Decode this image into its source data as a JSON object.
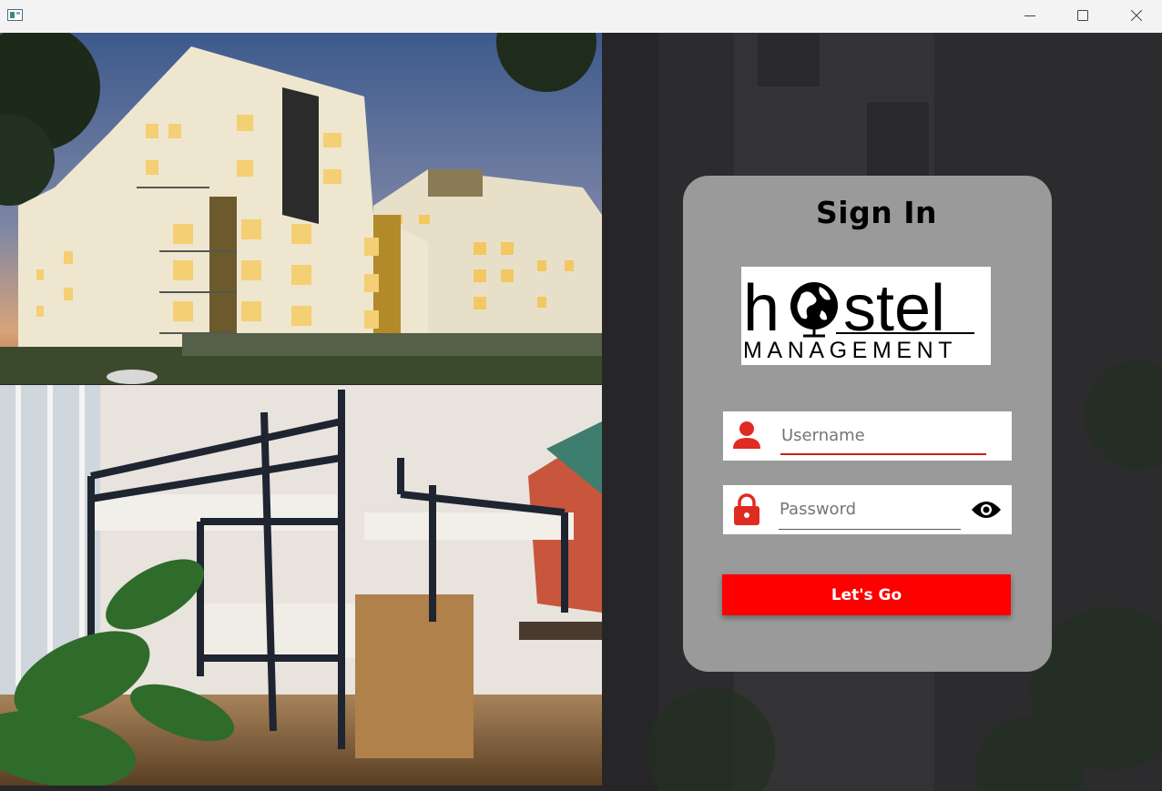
{
  "window": {
    "minimize_icon": "minimize-icon",
    "maximize_icon": "maximize-icon",
    "close_icon": "close-icon"
  },
  "signin": {
    "title": "Sign In",
    "logo": {
      "word": "hostel",
      "sub": "MANAGEMENT",
      "icon": "globe-icon"
    },
    "username": {
      "placeholder": "Username",
      "value": "",
      "icon": "user-icon"
    },
    "password": {
      "placeholder": "Password",
      "value": "",
      "icon": "lock-icon",
      "toggle_icon": "eye-icon"
    },
    "submit_label": "Let's Go"
  },
  "colors": {
    "accent": "#ff0000",
    "card": "#9a9a9a",
    "background": "#262528"
  }
}
